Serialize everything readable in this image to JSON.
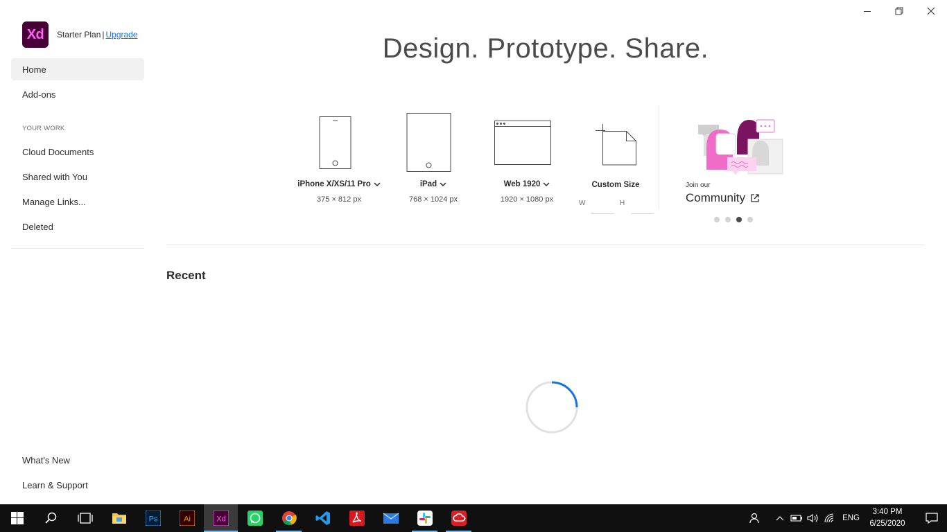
{
  "app": {
    "logo_text": "Xd",
    "plan_label": "Starter Plan",
    "plan_separator": "|",
    "upgrade_label": "Upgrade"
  },
  "sidebar": {
    "items": [
      {
        "label": "Home",
        "active": true
      },
      {
        "label": "Add-ons"
      }
    ],
    "section_title": "YOUR WORK",
    "work_items": [
      {
        "label": "Cloud Documents"
      },
      {
        "label": "Shared with You"
      },
      {
        "label": "Manage Links..."
      },
      {
        "label": "Deleted"
      }
    ],
    "footer_items": [
      {
        "label": "What's New"
      },
      {
        "label": "Learn & Support"
      }
    ]
  },
  "main": {
    "headline": "Design. Prototype. Share.",
    "presets": [
      {
        "name": "iPhone X/XS/11 Pro",
        "dims": "375 × 812 px",
        "icon": "phone-icon"
      },
      {
        "name": "iPad",
        "dims": "768 × 1024 px",
        "icon": "tablet-icon"
      },
      {
        "name": "Web 1920",
        "dims": "1920 × 1080 px",
        "icon": "browser-icon"
      },
      {
        "name": "Custom Size",
        "dims": "",
        "icon": "custom-document-icon"
      }
    ],
    "custom_w_label": "W",
    "custom_h_label": "H",
    "community": {
      "join_label": "Join our",
      "title": "Community",
      "carousel_total": 4,
      "carousel_active": 3
    },
    "recent_title": "Recent"
  },
  "taskbar": {
    "apps": [
      {
        "name": "start",
        "icon": "windows-icon"
      },
      {
        "name": "search",
        "icon": "search-icon"
      },
      {
        "name": "task-view",
        "icon": "task-view-icon"
      },
      {
        "name": "file-explorer",
        "icon": "folder-icon"
      },
      {
        "name": "photoshop",
        "icon": "photoshop-icon",
        "label": "Ps"
      },
      {
        "name": "illustrator",
        "icon": "illustrator-icon",
        "label": "Ai"
      },
      {
        "name": "xd",
        "icon": "xd-icon",
        "label": "Xd"
      },
      {
        "name": "whatsapp",
        "icon": "whatsapp-icon"
      },
      {
        "name": "chrome",
        "icon": "chrome-icon"
      },
      {
        "name": "vscode",
        "icon": "vscode-icon"
      },
      {
        "name": "acrobat",
        "icon": "acrobat-icon"
      },
      {
        "name": "mail",
        "icon": "mail-icon"
      },
      {
        "name": "slack",
        "icon": "slack-icon"
      },
      {
        "name": "creative-cloud",
        "icon": "creative-cloud-icon"
      }
    ],
    "language": "ENG",
    "time": "3:40 PM",
    "date": "6/25/2020"
  },
  "colors": {
    "xd_brand_bg": "#470137",
    "xd_brand_fg": "#ff61f6",
    "link": "#1473e6",
    "spinner": "#1473e6",
    "taskbar": "#101010"
  }
}
